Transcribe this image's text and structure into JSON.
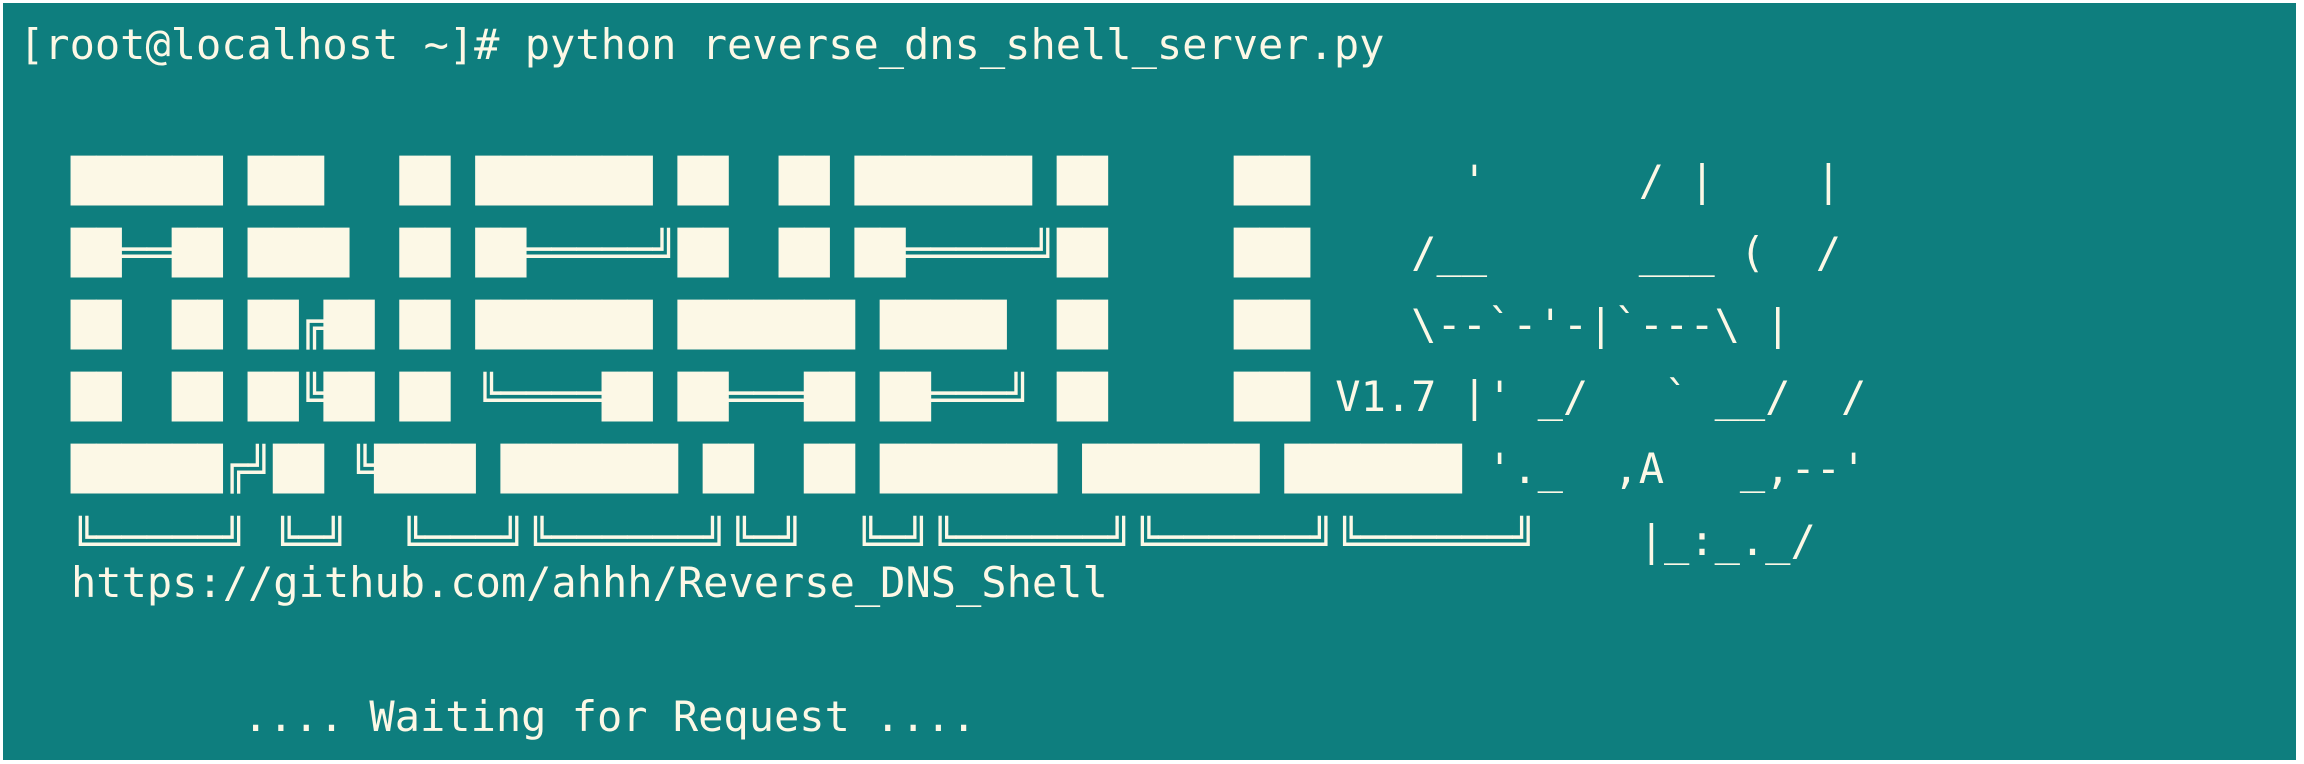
{
  "terminal": {
    "prompt_line": "[root@localhost ~]# python reverse_dns_shell_server.py",
    "banner_text": "██████ ███   ██ ███████ ██  ██ ███████ ██     ███      '      / |    |\n██══██ ████  ██ ██═════╝██  ██ ██═════╝██     ███    /__      ___ (  /\n██  ██ ██╔██ ██ ███████ ███████ █████  ██     ███    \\--`-'-|`---\\ |\n██  ██ ██╚██ ██ ╚════██ ██═══██ ██═══╝ ██     ███ V1.7 |' _/   ` __/  /\n██████╔╝██ ╚████ ███████ ██  ██ ███████ ███████ ███████ '._  ,A   _,--'\n╚═════╝ ╚═╝  ╚═══╝╚══════╝╚═╝  ╚═╝╚══════╝╚══════╝╚══════╝    |_:_._/",
    "url": "https://github.com/ahhh/Reverse_DNS_Shell",
    "status": ".... Waiting for Request ...."
  },
  "colors": {
    "background": "#0e7e7e",
    "foreground": "#fcf8e6",
    "frame": "#ffffff"
  }
}
